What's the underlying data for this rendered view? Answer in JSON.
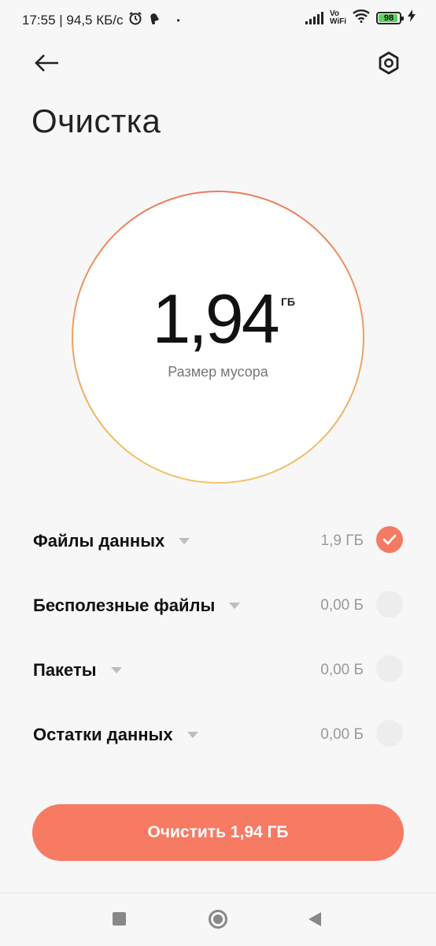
{
  "status_bar": {
    "time_speed": "17:55 | 94,5 КБ/с",
    "alarm_icon": "alarm-clock-icon",
    "bell_icon": "bell-icon",
    "dot": "•",
    "vowifi": "Vo WiFi",
    "battery_level": "98"
  },
  "header": {
    "back_icon": "arrow-left-icon",
    "settings_icon": "settings-hexagon-icon",
    "title": "Очистка"
  },
  "gauge": {
    "value": "1,94",
    "unit": "ГБ",
    "label": "Размер мусора",
    "ring_colors": [
      "#ee7a5a",
      "#f2c46a"
    ]
  },
  "items": [
    {
      "name": "Файлы данных",
      "size": "1,9 ГБ",
      "checked": true
    },
    {
      "name": "Бесполезные файлы",
      "size": "0,00 Б",
      "checked": false
    },
    {
      "name": "Пакеты",
      "size": "0,00 Б",
      "checked": false
    },
    {
      "name": "Остатки данных",
      "size": "0,00 Б",
      "checked": false
    }
  ],
  "action_button": {
    "label": "Очистить 1,94 ГБ"
  },
  "colors": {
    "accent": "#f77a63",
    "background": "#f7f7f7"
  }
}
